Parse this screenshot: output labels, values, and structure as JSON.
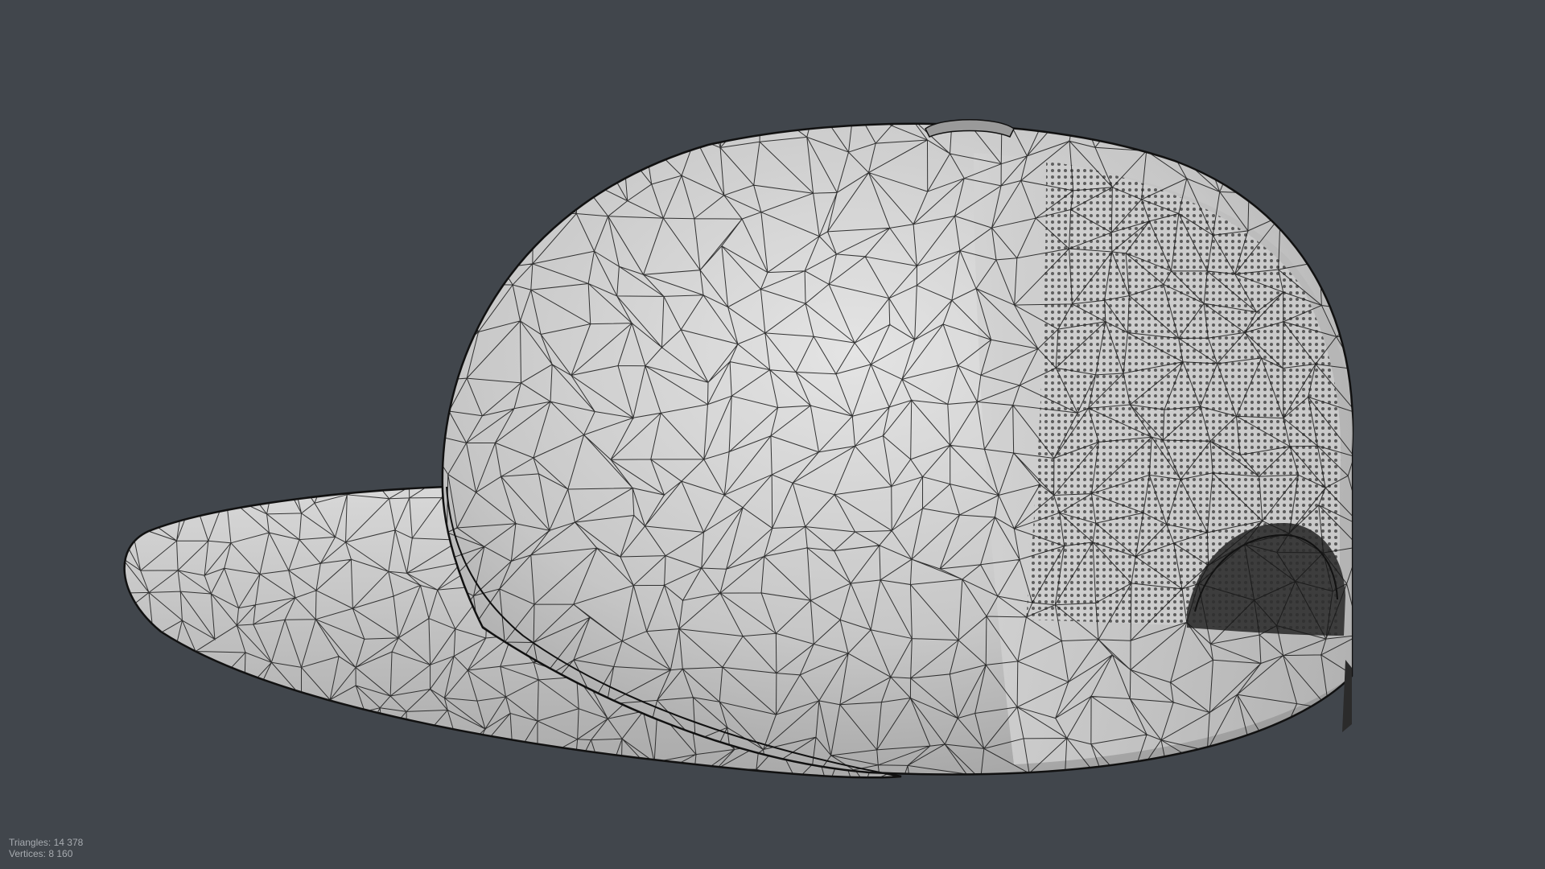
{
  "viewport": {
    "background_color": "#41464c",
    "model_fill_color": "#c9c9c9",
    "wire_color": "#111111"
  },
  "stats": {
    "triangles_label": "Triangles:",
    "triangles_value": "14 378",
    "vertices_label": "Vertices:",
    "vertices_value": "8 160"
  },
  "model": {
    "name_icon": "baseball-cap-wireframe-icon"
  }
}
